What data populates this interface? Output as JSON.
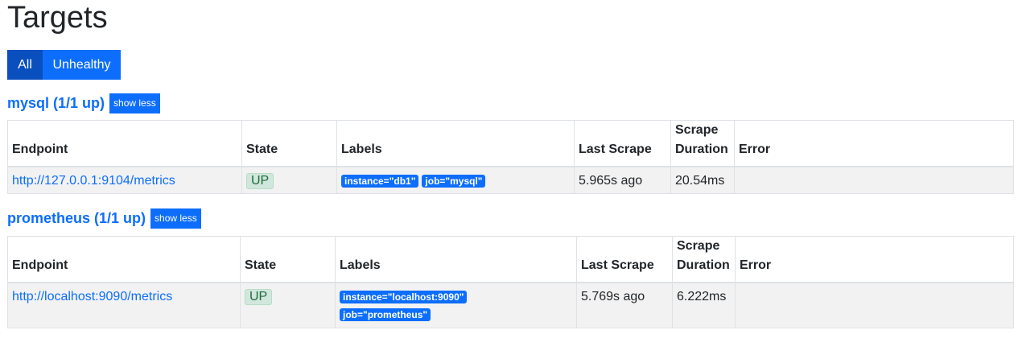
{
  "page": {
    "title": "Targets"
  },
  "filters": {
    "all": "All",
    "unhealthy": "Unhealthy"
  },
  "columns": {
    "endpoint": "Endpoint",
    "state": "State",
    "labels": "Labels",
    "last_scrape": "Last Scrape",
    "scrape_duration_line1": "Scrape",
    "scrape_duration_line2": "Duration",
    "error": "Error"
  },
  "pools": [
    {
      "title": "mysql (1/1 up)",
      "toggle": "show less",
      "targets": [
        {
          "endpoint": "http://127.0.0.1:9104/metrics",
          "state": "UP",
          "labels": [
            "instance=\"db1\"",
            "job=\"mysql\""
          ],
          "last_scrape": "5.965s ago",
          "scrape_duration": "20.54ms",
          "error": ""
        }
      ]
    },
    {
      "title": "prometheus (1/1 up)",
      "toggle": "show less",
      "targets": [
        {
          "endpoint": "http://localhost:9090/metrics",
          "state": "UP",
          "labels": [
            "instance=\"localhost:9090\"",
            "job=\"prometheus\""
          ],
          "last_scrape": "5.769s ago",
          "scrape_duration": "6.222ms",
          "error": ""
        }
      ]
    }
  ]
}
